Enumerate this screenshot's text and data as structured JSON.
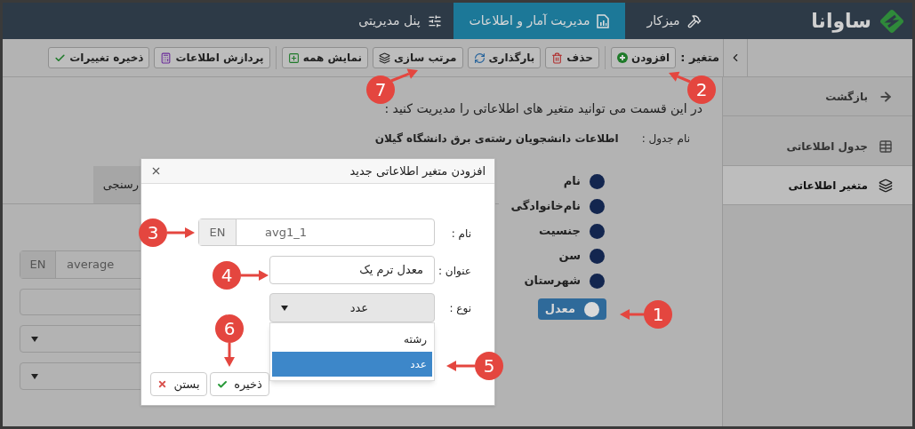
{
  "brand": {
    "name": "ساوانا"
  },
  "nav": [
    {
      "label": "میزکار",
      "selected": false,
      "kind": "desk"
    },
    {
      "label": "مدیریت آمار و اطلاعات",
      "selected": true,
      "kind": "stats"
    },
    {
      "label": "پنل مدیریتی",
      "selected": false,
      "kind": "panel"
    }
  ],
  "toolbar": {
    "label": "متغیر :",
    "buttons": [
      {
        "label": "افزودن",
        "kind": "add"
      },
      {
        "label": "حذف",
        "kind": "delete"
      },
      {
        "label": "بارگذاری",
        "kind": "reload"
      },
      {
        "label": "مرتب سازی",
        "kind": "sort"
      },
      {
        "label": "نمایش همه",
        "kind": "show-all"
      },
      {
        "label": "پردازش اطلاعات",
        "kind": "process"
      },
      {
        "label": "ذخیره تغییرات",
        "kind": "save"
      }
    ]
  },
  "sidebar": {
    "items": [
      {
        "label": "بازگشت",
        "selected": false,
        "kind": "back"
      },
      {
        "label": "جدول اطلاعاتی",
        "selected": false,
        "kind": "table"
      },
      {
        "label": "متغیر اطلاعاتی",
        "selected": true,
        "kind": "layers"
      }
    ]
  },
  "intro": "در این قسمت می توانید متغیر های اطلاعاتی را مدیریت کنید :",
  "table_name": {
    "label": "نام جدول :",
    "value": "اطلاعات دانشجویان رشته‌ی برق دانشگاه گیلان"
  },
  "variables": [
    {
      "label": "نام",
      "selected": false
    },
    {
      "label": "نام‌خانوادگی",
      "selected": false
    },
    {
      "label": "جنسیت",
      "selected": false
    },
    {
      "label": "سن",
      "selected": false
    },
    {
      "label": "شهرستان",
      "selected": false
    },
    {
      "label": "معدل",
      "selected": true
    }
  ],
  "background_form": {
    "tab": "رسنجی",
    "name_prefix": "EN",
    "name_value": "average"
  },
  "dialog": {
    "title": "افزودن متغیر اطلاعاتی جدید",
    "fields": [
      {
        "kind": "prefixed",
        "label": "نام :",
        "prefix": "EN",
        "value": "avg1_1"
      },
      {
        "kind": "text",
        "label": "عنوان :",
        "value": "معدل ترم یک"
      },
      {
        "kind": "select",
        "label": "نوع :",
        "value": "عدد",
        "options": [
          {
            "label": "رشته",
            "selected": false
          },
          {
            "label": "عدد",
            "selected": true
          }
        ]
      }
    ],
    "buttons": [
      {
        "label": "ذخیره",
        "kind": "save"
      },
      {
        "label": "بستن",
        "kind": "close"
      }
    ]
  },
  "callouts": [
    {
      "number": "1"
    },
    {
      "number": "2"
    },
    {
      "number": "3"
    },
    {
      "number": "4"
    },
    {
      "number": "5"
    },
    {
      "number": "6"
    },
    {
      "number": "7"
    }
  ]
}
